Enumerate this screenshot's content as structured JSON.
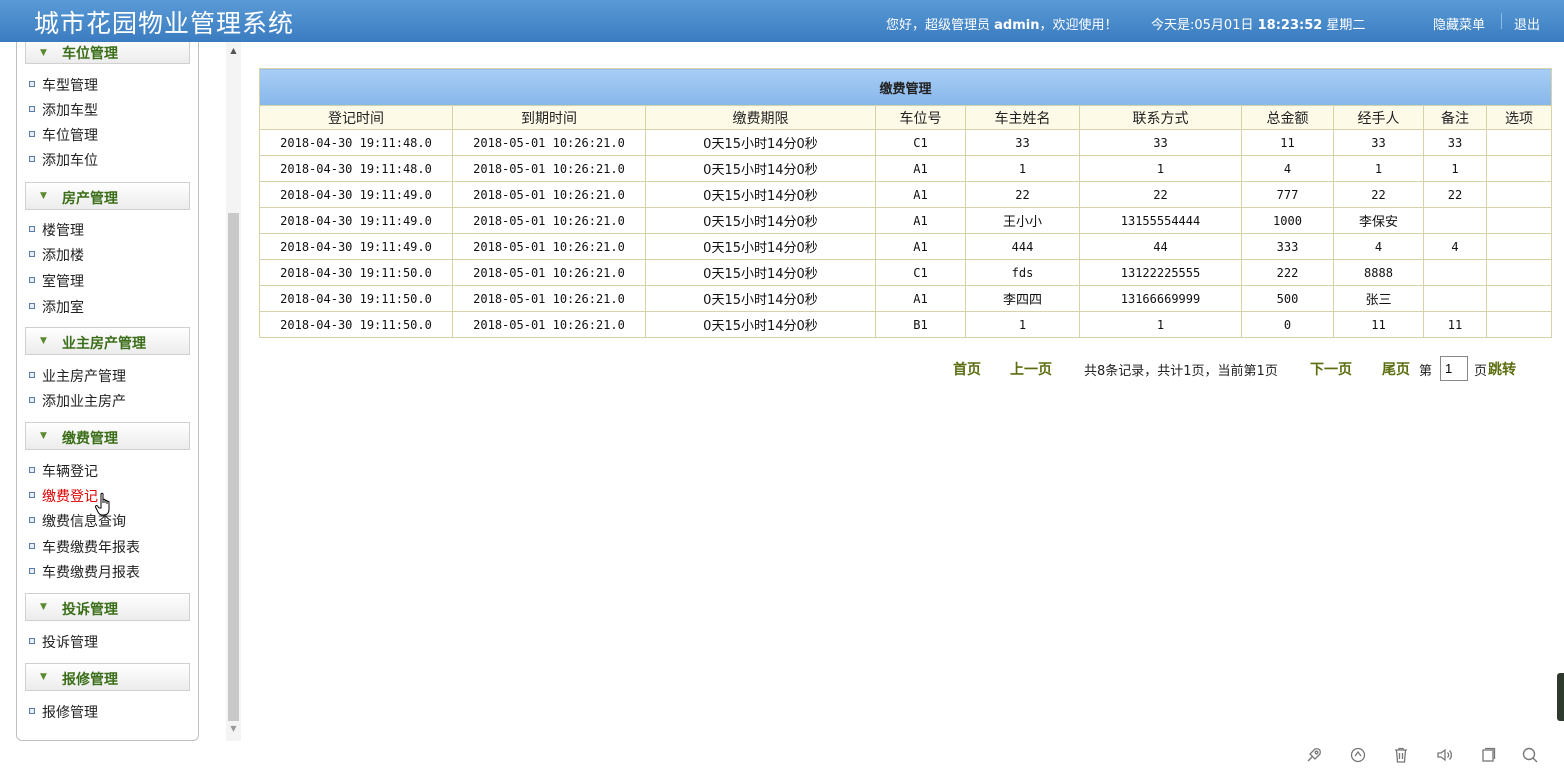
{
  "header": {
    "title": "城市花园物业管理系统",
    "greeting_prefix": "您好，超级管理员",
    "username": "admin",
    "greeting_suffix": "，欢迎使用！",
    "date_prefix": "今天是:05月01日",
    "time": "18:23:52",
    "weekday": "星期二",
    "hide_menu": "隐藏菜单",
    "logout": "退出"
  },
  "sidebar": {
    "groups": [
      {
        "title": "车位管理",
        "items": [
          "车型管理",
          "添加车型",
          "车位管理",
          "添加车位"
        ]
      },
      {
        "title": "房产管理",
        "items": [
          "楼管理",
          "添加楼",
          "室管理",
          "添加室"
        ]
      },
      {
        "title": "业主房产管理",
        "items": [
          "业主房产管理",
          "添加业主房产"
        ]
      },
      {
        "title": "缴费管理",
        "items": [
          "车辆登记",
          "缴费登记",
          "缴费信息查询",
          "车费缴费年报表",
          "车费缴费月报表"
        ]
      },
      {
        "title": "投诉管理",
        "items": [
          "投诉管理"
        ]
      },
      {
        "title": "报修管理",
        "items": [
          "报修管理"
        ]
      }
    ],
    "active_item": "缴费登记"
  },
  "table": {
    "caption": "缴费管理",
    "columns": [
      "登记时间",
      "到期时间",
      "缴费期限",
      "车位号",
      "车主姓名",
      "联系方式",
      "总金额",
      "经手人",
      "备注",
      "选项"
    ],
    "rows": [
      [
        "2018-04-30 19:11:48.0",
        "2018-05-01 10:26:21.0",
        "0天15小时14分0秒",
        "C1",
        "33",
        "33",
        "11",
        "33",
        "33",
        ""
      ],
      [
        "2018-04-30 19:11:48.0",
        "2018-05-01 10:26:21.0",
        "0天15小时14分0秒",
        "A1",
        "1",
        "1",
        "4",
        "1",
        "1",
        ""
      ],
      [
        "2018-04-30 19:11:49.0",
        "2018-05-01 10:26:21.0",
        "0天15小时14分0秒",
        "A1",
        "22",
        "22",
        "777",
        "22",
        "22",
        ""
      ],
      [
        "2018-04-30 19:11:49.0",
        "2018-05-01 10:26:21.0",
        "0天15小时14分0秒",
        "A1",
        "王小小",
        "13155554444",
        "1000",
        "李保安",
        "",
        ""
      ],
      [
        "2018-04-30 19:11:49.0",
        "2018-05-01 10:26:21.0",
        "0天15小时14分0秒",
        "A1",
        "444",
        "44",
        "333",
        "4",
        "4",
        ""
      ],
      [
        "2018-04-30 19:11:50.0",
        "2018-05-01 10:26:21.0",
        "0天15小时14分0秒",
        "C1",
        "fds",
        "13122225555",
        "222",
        "8888",
        "",
        ""
      ],
      [
        "2018-04-30 19:11:50.0",
        "2018-05-01 10:26:21.0",
        "0天15小时14分0秒",
        "A1",
        "李四四",
        "13166669999",
        "500",
        "张三",
        "",
        ""
      ],
      [
        "2018-04-30 19:11:50.0",
        "2018-05-01 10:26:21.0",
        "0天15小时14分0秒",
        "B1",
        "1",
        "1",
        "0",
        "11",
        "11",
        ""
      ]
    ]
  },
  "pager": {
    "first": "首页",
    "prev": "上一页",
    "summary": "共8条记录，共计1页，当前第1页",
    "next": "下一页",
    "last": "尾页",
    "page_label": "第",
    "page_value": "1",
    "page_suffix": "页",
    "jump": "跳转"
  },
  "toolbar_icons": [
    "rocket-icon",
    "refresh-icon",
    "trash-icon",
    "volume-icon",
    "window-icon",
    "search-icon"
  ],
  "colors": {
    "header_bg": "#3a7cc0",
    "caption_bg": "#86b7ea",
    "group_title": "#3b6e18",
    "active_item": "#e00000",
    "pager_link": "#5a6e10"
  }
}
